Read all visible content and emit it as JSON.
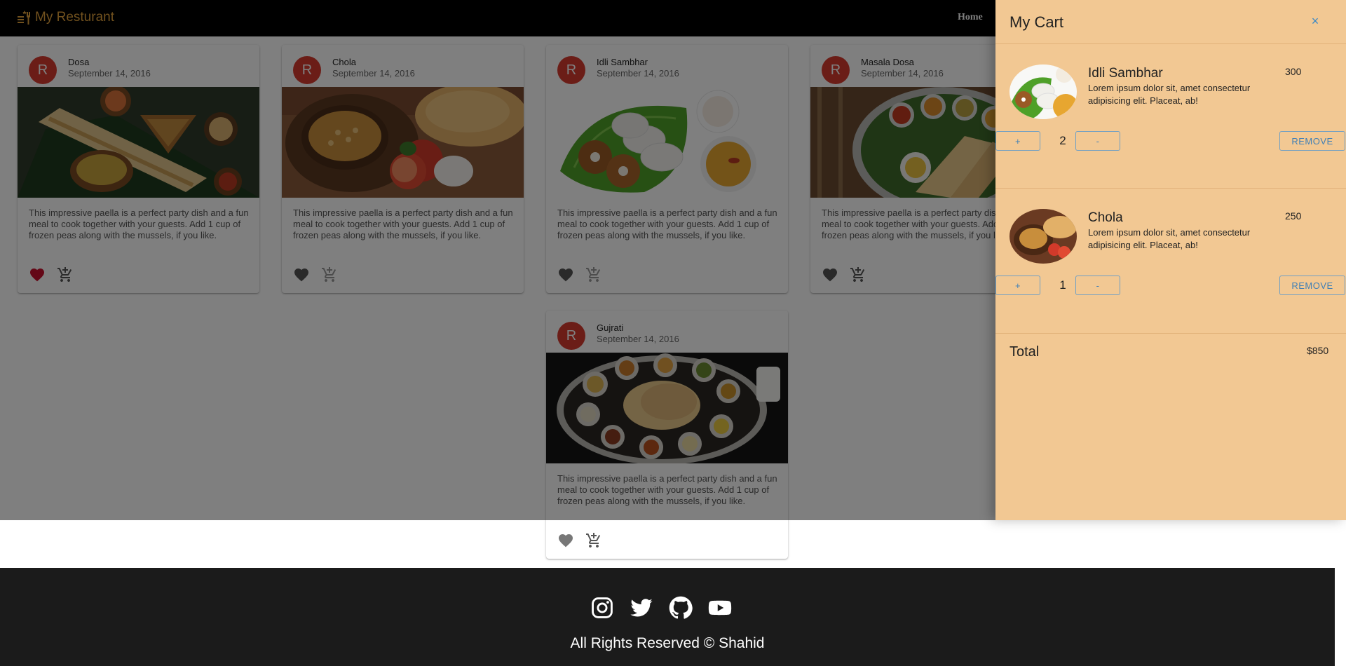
{
  "navbar": {
    "brand": "My Resturant",
    "home_label": "Home",
    "brand_color": "#e2a23c"
  },
  "cards": [
    {
      "avatar": "R",
      "title": "Dosa",
      "date": "September 14, 2016",
      "text": "This impressive paella is a perfect party dish and a fun meal to cook together with your guests. Add 1 cup of frozen peas along with the mussels, if you like.",
      "favorited": true
    },
    {
      "avatar": "R",
      "title": "Chola",
      "date": "September 14, 2016",
      "text": "This impressive paella is a perfect party dish and a fun meal to cook together with your guests. Add 1 cup of frozen peas along with the mussels, if you like.",
      "favorited": false
    },
    {
      "avatar": "R",
      "title": "Idli Sambhar",
      "date": "September 14, 2016",
      "text": "This impressive paella is a perfect party dish and a fun meal to cook together with your guests. Add 1 cup of frozen peas along with the mussels, if you like.",
      "favorited": false
    },
    {
      "avatar": "R",
      "title": "Masala Dosa",
      "date": "September 14, 2016",
      "text": "This impressive paella is a perfect party dish and a fun meal to cook together with your guests. Add 1 cup of frozen peas along with the mussels, if you like.",
      "favorited": false
    },
    {
      "avatar": "R",
      "title": "Gujrati",
      "date": "September 14, 2016",
      "text": "This impressive paella is a perfect party dish and a fun meal to cook together with your guests. Add 1 cup of frozen peas along with the mussels, if you like.",
      "favorited": false
    }
  ],
  "cart": {
    "title": "My Cart",
    "close_label": "×",
    "items": [
      {
        "name": "Idli Sambhar",
        "desc": "Lorem ipsum dolor sit, amet consectetur adipisicing elit. Placeat, ab!",
        "price": "300",
        "qty": "2",
        "plus_label": "+",
        "minus_label": "-",
        "remove_label": "REMOVE"
      },
      {
        "name": "Chola",
        "desc": "Lorem ipsum dolor sit, amet consectetur adipisicing elit. Placeat, ab!",
        "price": "250",
        "qty": "1",
        "plus_label": "+",
        "minus_label": "-",
        "remove_label": "REMOVE"
      }
    ],
    "total_label": "Total",
    "total_value": "$850",
    "background_color": "#f2c893",
    "accent_color": "#3f7fb6"
  },
  "footer": {
    "copyright": "All Rights Reserved © Shahid",
    "social_icons": [
      "instagram-icon",
      "twitter-icon",
      "github-icon",
      "youtube-icon"
    ]
  },
  "colors": {
    "avatar": "#d63b2f",
    "favorite_active": "#c8102e",
    "icon_gray": "#666666"
  }
}
